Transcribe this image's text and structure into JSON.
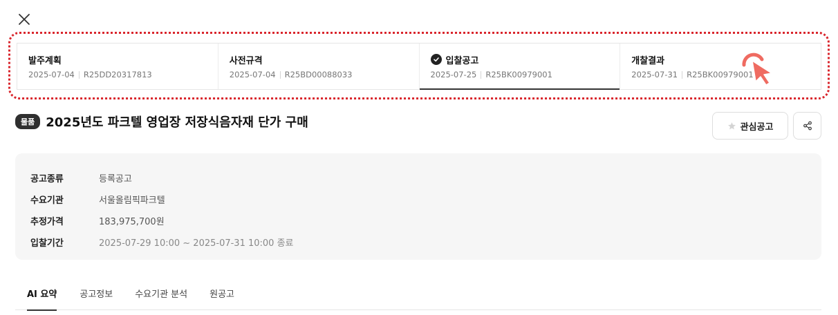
{
  "steps": [
    {
      "title": "발주계획",
      "date": "2025-07-04",
      "code": "R25DD20317813"
    },
    {
      "title": "사전규격",
      "date": "2025-07-04",
      "code": "R25BD00088033"
    },
    {
      "title": "입찰공고",
      "date": "2025-07-25",
      "code": "R25BK00979001"
    },
    {
      "title": "개찰결과",
      "date": "2025-07-31",
      "code": "R25BK00979001"
    }
  ],
  "header": {
    "badge": "물품",
    "title": "2025년도 파크텔 영업장 저장식음자재 단가 구매",
    "fav_label": "관심공고"
  },
  "info": [
    {
      "label": "공고종류",
      "value": "등록공고"
    },
    {
      "label": "수요기관",
      "value": "서울올림픽파크텔"
    },
    {
      "label": "추정가격",
      "value": "183,975,700원"
    },
    {
      "label": "입찰기간",
      "value": "2025-07-29 10:00 ~  2025-07-31 10:00 종료"
    }
  ],
  "tabs": [
    "AI 요약",
    "공고정보",
    "수요기관 분석",
    "원공고"
  ],
  "colors": {
    "highlight": "#d9252c",
    "cursor": "#ef6b61"
  }
}
